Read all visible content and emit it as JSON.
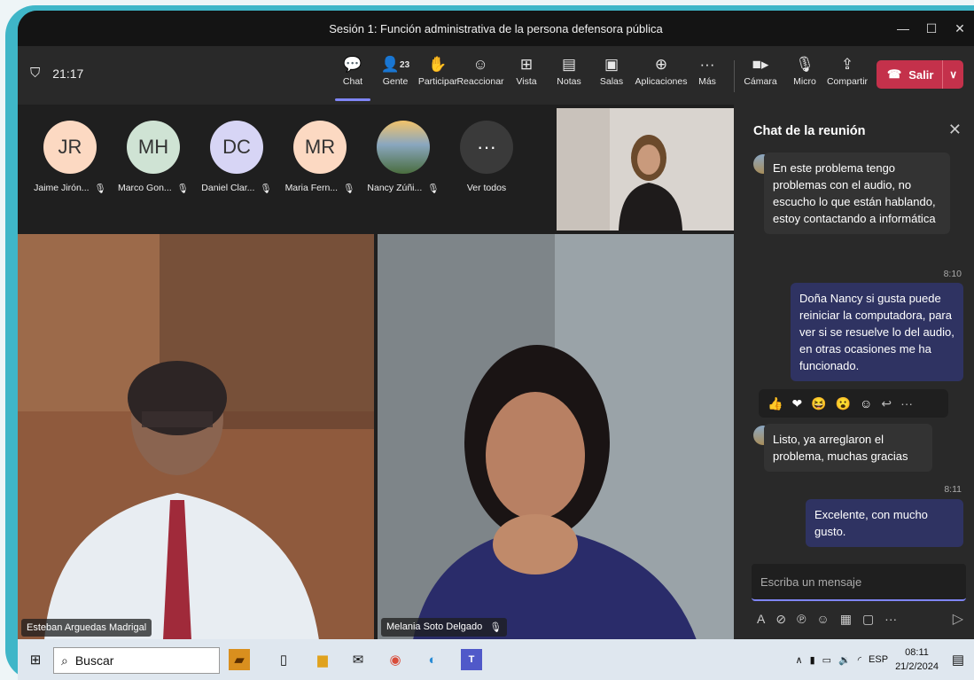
{
  "window": {
    "title": "Sesión 1: Función administrativa de la persona defensora pública",
    "min": "—",
    "max": "☐",
    "close": "✕"
  },
  "toolbar": {
    "time": "21:17",
    "participants_count": "23",
    "buttons": [
      {
        "label": "Chat",
        "icon": "chat-icon",
        "glyph": "💬"
      },
      {
        "label": "Gente",
        "icon": "people-icon",
        "glyph": "👥"
      },
      {
        "label": "Participar",
        "icon": "hand-icon",
        "glyph": "✋"
      },
      {
        "label": "Reaccionar",
        "icon": "smiley-icon",
        "glyph": "☺"
      },
      {
        "label": "Vista",
        "icon": "grid-icon",
        "glyph": "⊞"
      },
      {
        "label": "Notas",
        "icon": "notes-icon",
        "glyph": "▤"
      },
      {
        "label": "Salas",
        "icon": "rooms-icon",
        "glyph": "▣"
      },
      {
        "label": "Aplicaciones",
        "icon": "apps-icon",
        "glyph": "⊕"
      },
      {
        "label": "Más",
        "icon": "more-icon",
        "glyph": "···"
      },
      {
        "label": "Cámara",
        "icon": "camera-icon",
        "glyph": "■"
      },
      {
        "label": "Micro",
        "icon": "mic-off-icon",
        "glyph": "🎙"
      },
      {
        "label": "Compartir",
        "icon": "share-icon",
        "glyph": "⇪"
      }
    ],
    "leave_label": "Salir",
    "leave_color": "#c4314b",
    "accent": "#7f85f5"
  },
  "participants": [
    {
      "initials": "JR",
      "name": "Jaime Jirón...",
      "color": "#fcd9c2"
    },
    {
      "initials": "MH",
      "name": "Marco Gon...",
      "color": "#cfe3d4"
    },
    {
      "initials": "DC",
      "name": "Daniel Clar...",
      "color": "#d7d5f5"
    },
    {
      "initials": "MR",
      "name": "Maria Fern...",
      "color": "#fcd9c2"
    },
    {
      "initials": "",
      "name": "Nancy Zúñi...",
      "color": "#9bb6c9"
    },
    {
      "initials": "···",
      "name": "Ver todos",
      "color": "#3a3a3a"
    }
  ],
  "videos": [
    {
      "name": "Esteban Arguedas Madrigal"
    },
    {
      "name": "Melania Soto Delgado"
    }
  ],
  "chat": {
    "title": "Chat de la reunión",
    "messages": [
      {
        "text": "En este problema tengo problemas con el audio, no escucho lo que están hablando, estoy contactando a informática"
      },
      {
        "time": "8:10",
        "text": "Doña Nancy si gusta puede reiniciar la computadora, para ver si se resuelve lo del audio, en otras ocasiones me ha funcionado."
      },
      {
        "text": "Listo, ya arreglaron el problema, muchas gracias"
      },
      {
        "time": "8:11",
        "text": "Excelente, con mucho gusto."
      }
    ],
    "compose_placeholder": "Escriba un mensaje"
  },
  "taskbar": {
    "search_label": "Buscar",
    "lang": "ESP",
    "time": "08:11",
    "date": "21/2/2024"
  }
}
